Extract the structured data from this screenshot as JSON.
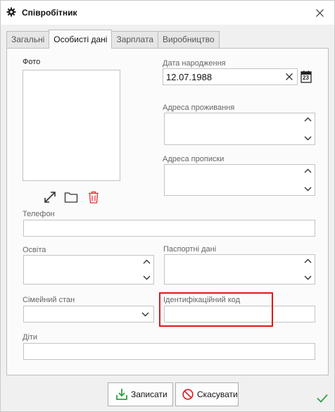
{
  "window": {
    "title": "Співробітник",
    "title_icon": "gear-icon",
    "close_icon": "close-icon"
  },
  "tabs": [
    {
      "label": "Загальні",
      "active": false
    },
    {
      "label": "Особисті дані",
      "active": true
    },
    {
      "label": "Зарплата",
      "active": false
    },
    {
      "label": "Виробництво",
      "active": false
    }
  ],
  "form": {
    "photo_label": "Фото",
    "birth_date_label": "Дата народження",
    "birth_date_value": "12.07.1988",
    "calendar_day": "23",
    "residence_label": "Адреса проживання",
    "registration_label": "Адреса прописки",
    "phone_label": "Телефон",
    "education_label": "Освіта",
    "passport_label": "Паспортні дані",
    "marital_label": "Сімейний стан",
    "tax_id_label": "Ідентифікаційний код",
    "children_label": "Діти"
  },
  "photo_tools": [
    "expand-icon",
    "folder-icon",
    "trash-icon"
  ],
  "footer": {
    "save_label": "Записати",
    "cancel_label": "Скасувати",
    "accent_green": "#2ea043",
    "accent_red": "#e01818"
  }
}
